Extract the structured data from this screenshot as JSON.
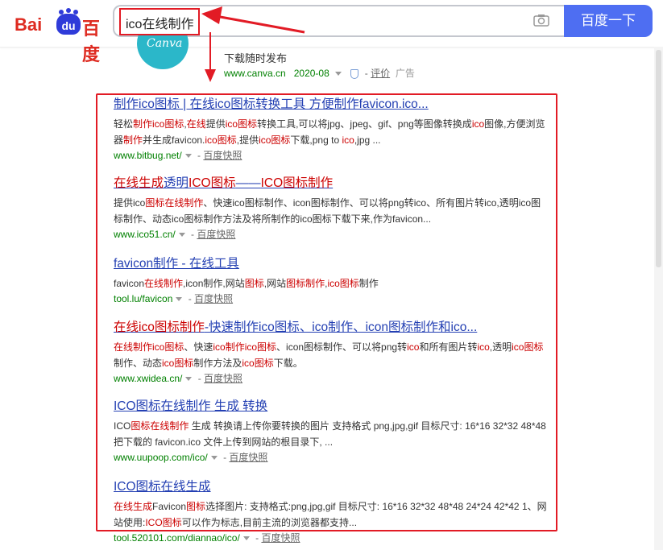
{
  "header": {
    "logo_bai": "Bai",
    "logo_du": "du",
    "logo_cn": "百度",
    "query": "ico在线制作",
    "search_button": "百度一下"
  },
  "ad": {
    "logo_text": "Canva",
    "line1": "下载随时发布",
    "url": "www.canva.cn",
    "date": "2020-08",
    "eval": "评价",
    "ad_label": "广告"
  },
  "results": [
    {
      "title_parts": [
        {
          "t": "制作ico图标 | 在线ico图标转换工具 方便制作favicon.ico...",
          "em": false
        }
      ],
      "abstract": [
        {
          "t": "轻松",
          "em": false
        },
        {
          "t": "制作ico图标",
          "em": true
        },
        {
          "t": ",",
          "em": false
        },
        {
          "t": "在线",
          "em": true
        },
        {
          "t": "提供",
          "em": false
        },
        {
          "t": "ico图标",
          "em": true
        },
        {
          "t": "转换工具,可以将jpg、jpeg、gif、png等图像转换成",
          "em": false
        },
        {
          "t": "ico",
          "em": true
        },
        {
          "t": "图像,方便浏览器",
          "em": false
        },
        {
          "t": "制作",
          "em": true
        },
        {
          "t": "并生成favicon.",
          "em": false
        },
        {
          "t": "ico图标",
          "em": true
        },
        {
          "t": ",提供",
          "em": false
        },
        {
          "t": "ico图标",
          "em": true
        },
        {
          "t": "下载,png to ",
          "em": false
        },
        {
          "t": "ico",
          "em": true
        },
        {
          "t": ",jpg ...",
          "em": false
        }
      ],
      "url": "www.bitbug.net/",
      "snapshot": "百度快照"
    },
    {
      "title_parts": [
        {
          "t": "在线生成",
          "em": true
        },
        {
          "t": "透明",
          "em": false
        },
        {
          "t": "ICO图标",
          "em": true
        },
        {
          "t": "——",
          "em": false
        },
        {
          "t": "ICO图标制作",
          "em": true
        }
      ],
      "abstract": [
        {
          "t": "提供ico",
          "em": false
        },
        {
          "t": "图标在线制作",
          "em": true
        },
        {
          "t": "、快速ico图标制作、icon图标制作、可以将png转ico、所有图片转ico,透明ico图标制作、动态ico图标制作方法及将所制作的ico图标下载下来,作为favicon...",
          "em": false
        }
      ],
      "url": "www.ico51.cn/",
      "snapshot": "百度快照"
    },
    {
      "title_parts": [
        {
          "t": "favicon制作 - 在线工具",
          "em": false
        }
      ],
      "abstract": [
        {
          "t": "favicon",
          "em": false
        },
        {
          "t": "在线制作",
          "em": true
        },
        {
          "t": ",icon制作,网站",
          "em": false
        },
        {
          "t": "图标",
          "em": true
        },
        {
          "t": ",网站",
          "em": false
        },
        {
          "t": "图标制作",
          "em": true
        },
        {
          "t": ",",
          "em": false
        },
        {
          "t": "ico图标",
          "em": true
        },
        {
          "t": "制作",
          "em": false
        }
      ],
      "url": "tool.lu/favicon",
      "snapshot": "百度快照"
    },
    {
      "title_parts": [
        {
          "t": "在线ico图标制作",
          "em": true
        },
        {
          "t": "-快速制作ico图标、ico制作、icon图标制作和ico...",
          "em": false
        }
      ],
      "abstract": [
        {
          "t": "在线制作ico图标",
          "em": true
        },
        {
          "t": "、快速",
          "em": false
        },
        {
          "t": "ico制作ico图标",
          "em": true
        },
        {
          "t": "、icon图标制作、可以将png转",
          "em": false
        },
        {
          "t": "ico",
          "em": true
        },
        {
          "t": "和所有图片转",
          "em": false
        },
        {
          "t": "ico",
          "em": true
        },
        {
          "t": ",透明",
          "em": false
        },
        {
          "t": "ico图标",
          "em": true
        },
        {
          "t": "制作、动态",
          "em": false
        },
        {
          "t": "ico图标",
          "em": true
        },
        {
          "t": "制作方法及",
          "em": false
        },
        {
          "t": "ico图标",
          "em": true
        },
        {
          "t": "下载。",
          "em": false
        }
      ],
      "url": "www.xwidea.cn/",
      "snapshot": "百度快照"
    },
    {
      "title_parts": [
        {
          "t": "ICO图标在线制作 生成 转换",
          "em": false
        }
      ],
      "abstract": [
        {
          "t": "ICO",
          "em": false
        },
        {
          "t": "图标在线制作",
          "em": true
        },
        {
          "t": " 生成 转换请上传你要转换的图片 支持格式 png,jpg,gif 目标尺寸: 16*16 32*32 48*48 把下载的 favicon.ico 文件上传到网站的根目录下, ...",
          "em": false
        }
      ],
      "url": "www.uupoop.com/ico/",
      "snapshot": "百度快照"
    },
    {
      "title_parts": [
        {
          "t": "ICO图标在线生成",
          "em": false
        }
      ],
      "abstract": [
        {
          "t": "在线生成",
          "em": true
        },
        {
          "t": "Favicon",
          "em": false
        },
        {
          "t": "图标",
          "em": true
        },
        {
          "t": "选择图片: 支持格式:png,jpg,gif 目标尺寸: 16*16 32*32 48*48 24*24 42*42 1、网站使用:",
          "em": false
        },
        {
          "t": "ICO图标",
          "em": true
        },
        {
          "t": "可以作为标志,目前主流的浏览器都支持...",
          "em": false
        }
      ],
      "url": "tool.520101.com/diannao/ico/",
      "snapshot": "百度快照"
    }
  ]
}
